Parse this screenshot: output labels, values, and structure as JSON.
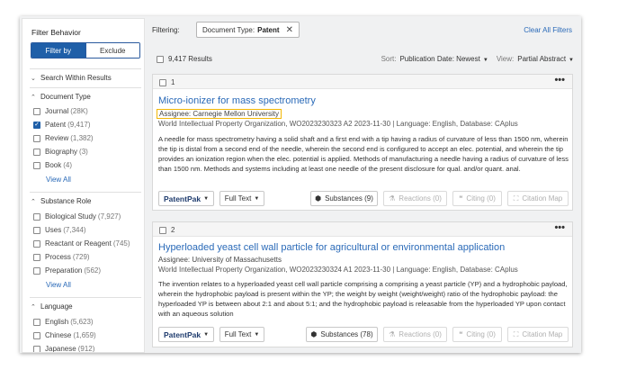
{
  "sidebar": {
    "title": "Filter Behavior",
    "filter_by": "Filter by",
    "exclude": "Exclude",
    "search_within": "Search Within Results",
    "document_type": {
      "heading": "Document Type",
      "items": [
        {
          "label": "Journal",
          "count": "(28K)",
          "checked": false
        },
        {
          "label": "Patent",
          "count": "(9,417)",
          "checked": true
        },
        {
          "label": "Review",
          "count": "(1,382)",
          "checked": false
        },
        {
          "label": "Biography",
          "count": "(3)",
          "checked": false
        },
        {
          "label": "Book",
          "count": "(4)",
          "checked": false
        }
      ],
      "view_all": "View All"
    },
    "substance_role": {
      "heading": "Substance Role",
      "items": [
        {
          "label": "Biological Study",
          "count": "(7,927)"
        },
        {
          "label": "Uses",
          "count": "(7,344)"
        },
        {
          "label": "Reactant or Reagent",
          "count": "(745)"
        },
        {
          "label": "Process",
          "count": "(729)"
        },
        {
          "label": "Preparation",
          "count": "(562)"
        }
      ],
      "view_all": "View All"
    },
    "language": {
      "heading": "Language",
      "items": [
        {
          "label": "English",
          "count": "(5,623)"
        },
        {
          "label": "Chinese",
          "count": "(1,659)"
        },
        {
          "label": "Japanese",
          "count": "(912)"
        }
      ]
    }
  },
  "toolbar": {
    "filtering_label": "Filtering:",
    "chip_label": "Document Type:",
    "chip_value": "Patent",
    "clear_all": "Clear All Filters",
    "results_count": "9,417 Results",
    "sort_label": "Sort:",
    "sort_value": "Publication Date: Newest",
    "view_label": "View:",
    "view_value": "Partial Abstract"
  },
  "results": [
    {
      "number": "1",
      "title": "Micro-ionizer for mass spectrometry",
      "assignee": "Assignee: Carnegie Mellon University",
      "meta": "World Intellectual Property Organization, WO2023230323 A2 2023-11-30 | Language: English, Database: CAplus",
      "abstract": "A needle for mass spectrometry having a solid shaft and a first end with a tip having a radius of curvature of less than 1500 nm, wherein the tip is distal from a second end of the needle, wherein the second end is configured to accept an elec. potential, and wherein the tip provides an ionization region when the elec. potential is applied. Methods of manufacturing a needle having a radius of curvature of less than 1500 nm. Methods and systems including at least one needle of the present disclosure for qual. and/or quant. anal.",
      "substances": "Substances (9)"
    },
    {
      "number": "2",
      "title": "Hyperloaded yeast cell wall particle for agricultural or environmental application",
      "assignee": "Assignee: University of Massachusetts",
      "meta": "World Intellectual Property Organization, WO2023230324 A1 2023-11-30 | Language: English, Database: CAplus",
      "abstract": "The invention relates to a hyperloaded yeast cell wall particle comprising a comprising a yeast particle (YP) and a hydrophobic payload, wherein the hydrophobic payload is present within the YP; the weight by weight (weight/weight) ratio of the hydrophobic payload: the hyperloaded YP is between about 2:1 and about 5:1; and the hydrophobic payload is releasable from the hyperloaded YP upon contact with an aqueous solution",
      "substances": "Substances (78)"
    }
  ],
  "actions": {
    "patentpak": "PatentPak",
    "fulltext": "Full Text",
    "reactions": "Reactions (0)",
    "citing": "Citing (0)",
    "citation_map": "Citation Map"
  },
  "colors": {
    "accent": "#1f5fa8",
    "link": "#2a6ab8",
    "highlight": "#f2b705"
  }
}
